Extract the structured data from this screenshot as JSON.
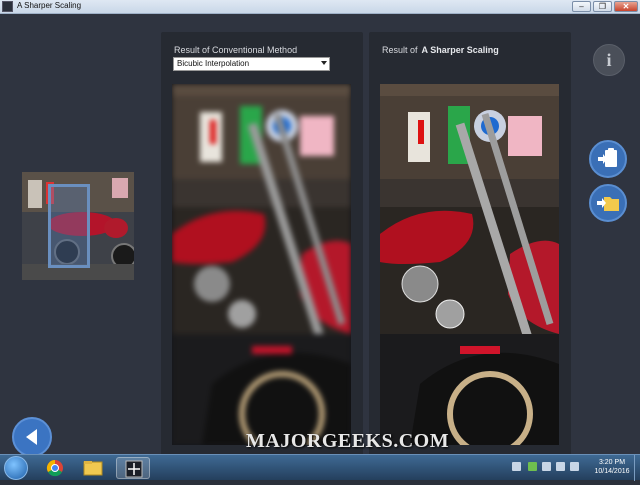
{
  "window": {
    "title": "A Sharper Scaling",
    "minimize": "–",
    "restore": "❐",
    "close": "✕"
  },
  "left_panel": {
    "caption": "Result of Conventional Method",
    "method_select": {
      "value": "Bicubic Interpolation"
    }
  },
  "right_panel": {
    "caption_prefix": "Result of",
    "caption_name": "A Sharper Scaling"
  },
  "buttons": {
    "info": "i",
    "clipboard_icon": "clipboard-icon",
    "folder_icon": "folder-icon",
    "back_icon": "back-arrow-icon"
  },
  "watermark": "MAJORGEEKS.COM",
  "taskbar": {
    "items": [
      "start-icon",
      "chrome-icon",
      "file-explorer-icon",
      "a-sharper-scaling-icon"
    ],
    "clock_time": "3:20 PM",
    "clock_date": "10/14/2016"
  },
  "colors": {
    "accent": "#3a6fb6",
    "panel": "#262a32",
    "background": "#2f3440",
    "motorcycle_red": "#c0142a"
  }
}
